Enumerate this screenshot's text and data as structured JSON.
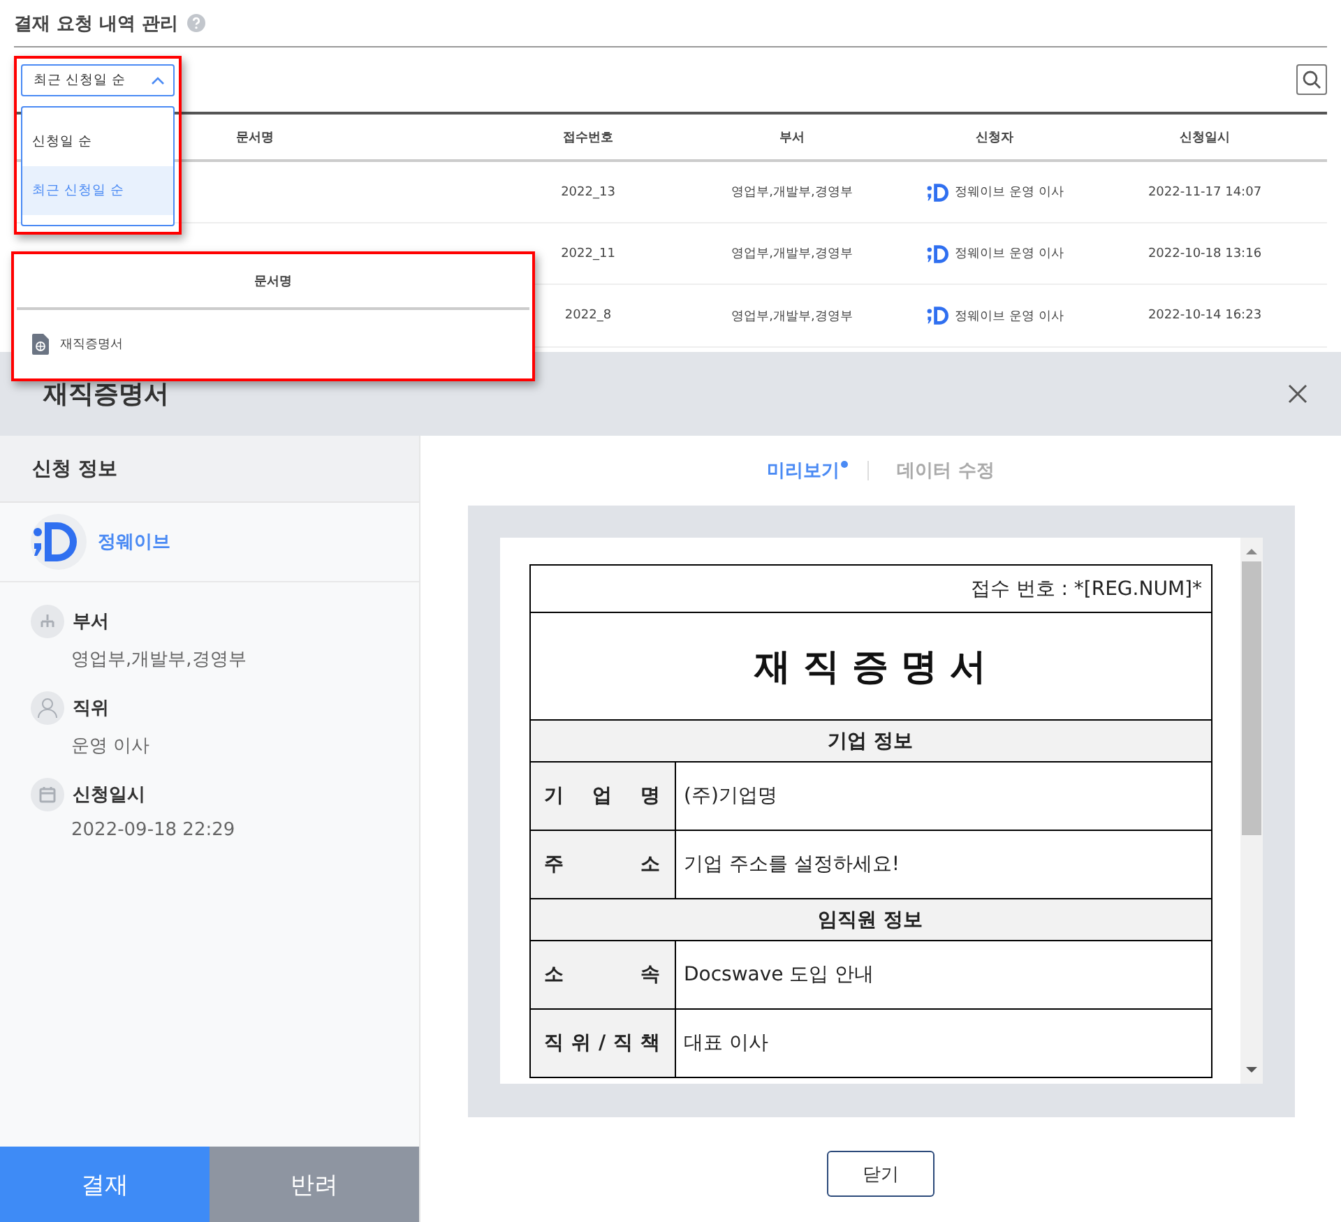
{
  "page": {
    "title": "결재 요청 내역 관리"
  },
  "sort": {
    "value": "최근 신청일 순",
    "expanded": true,
    "options": [
      {
        "label": "신청일 순",
        "selected": false
      },
      {
        "label": "최근 신청일 순",
        "selected": true
      }
    ]
  },
  "table": {
    "columns": [
      "문서명",
      "접수번호",
      "부서",
      "신청자",
      "신청일시"
    ],
    "rows": [
      {
        "number": "2022_13",
        "department": "영업부,개발부,경영부",
        "applicant": "정웨이브 운영 이사",
        "date": "2022-11-17 14:07"
      },
      {
        "number": "2022_11",
        "department": "영업부,개발부,경영부",
        "applicant": "정웨이브 운영 이사",
        "date": "2022-10-18 13:16"
      },
      {
        "number": "2022_8",
        "department": "영업부,개발부,경영부",
        "applicant": "정웨이브 운영 이사",
        "date": "2022-10-14 16:23"
      }
    ]
  },
  "callout": {
    "column": "문서명",
    "document": "재직증명서"
  },
  "modal": {
    "title": "재직증명서",
    "info_title": "신청 정보",
    "user": "정웨이브",
    "fields": [
      {
        "kind": "department",
        "label": "부서",
        "value": "영업부,개발부,경영부"
      },
      {
        "kind": "position",
        "label": "직위",
        "value": "운영 이사"
      },
      {
        "kind": "date",
        "label": "신청일시",
        "value": "2022-09-18 22:29"
      }
    ],
    "tabs": [
      {
        "label": "미리보기",
        "selected": true
      },
      {
        "label": "데이터 수정",
        "selected": false
      }
    ],
    "document": {
      "reg_line": "접수 번호 : *[REG.NUM]*",
      "heading": "재 직 증 명 서",
      "sections": [
        {
          "title": "기업 정보",
          "rows": [
            {
              "label": "기 업 명",
              "value": "(주)기업명"
            },
            {
              "label": "주 소",
              "value": "기업 주소를 설정하세요!"
            }
          ]
        },
        {
          "title": "임직원 정보",
          "rows": [
            {
              "label": "소 속",
              "value": "Docswave 도입 안내"
            },
            {
              "label": "직 위 / 직 책",
              "value": "대표 이사"
            }
          ]
        }
      ]
    },
    "approve": "결재",
    "reject": "반려",
    "close": "닫기"
  }
}
